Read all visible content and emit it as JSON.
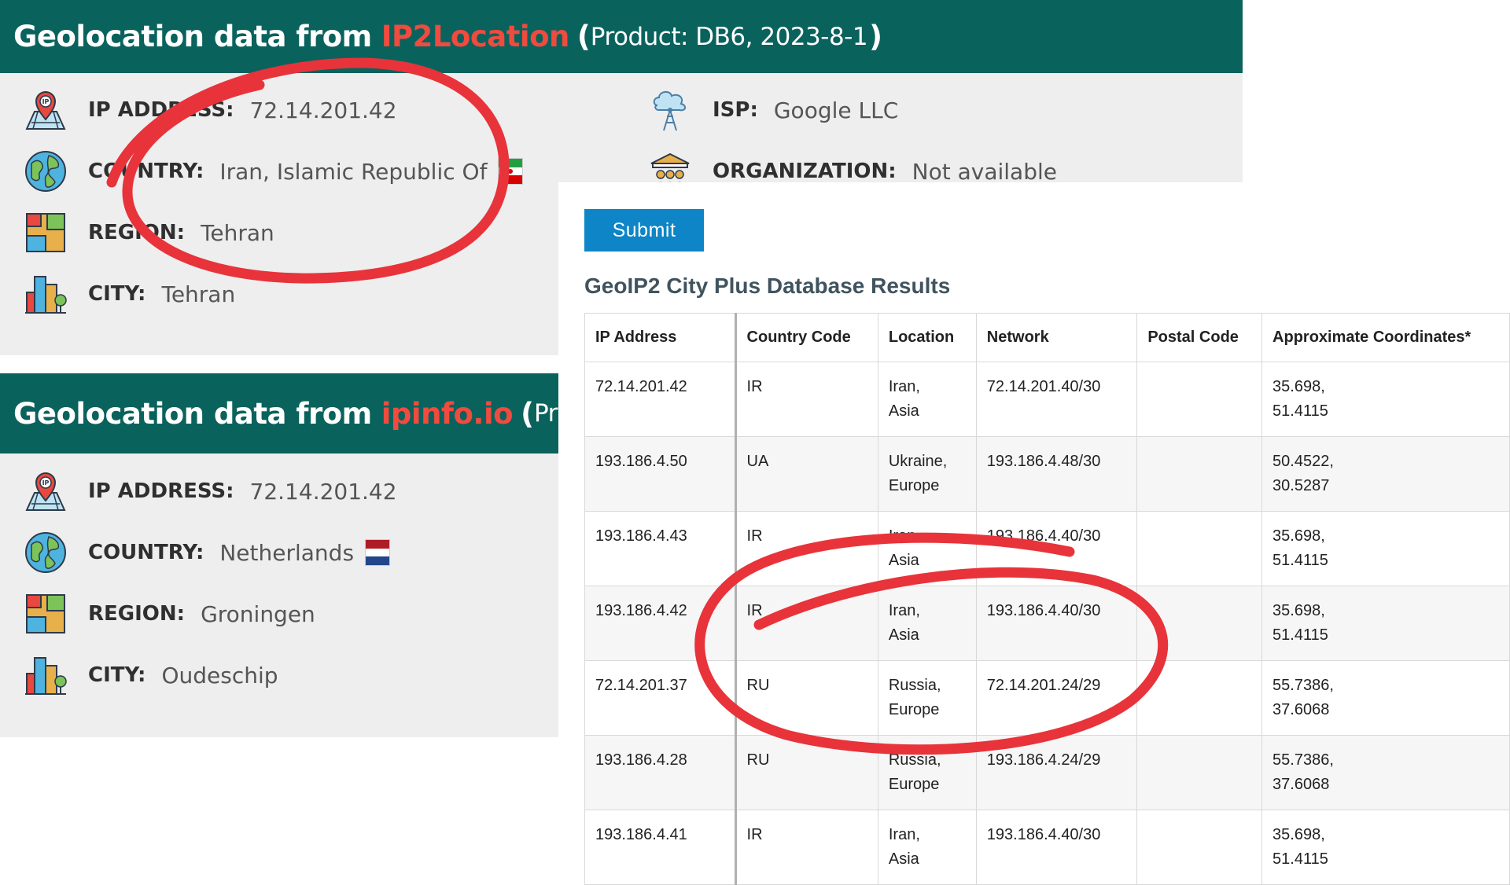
{
  "ip2location": {
    "header_main": "Geolocation data from",
    "header_brand": "IP2Location",
    "header_product": "Product: DB6, 2023-8-1",
    "rows": [
      {
        "label": "IP ADDRESS:",
        "value": "72.14.201.42",
        "icon": "ip-pin-icon"
      },
      {
        "label": "COUNTRY:",
        "value": "Iran, Islamic Republic Of",
        "icon": "globe-icon"
      },
      {
        "label": "REGION:",
        "value": "Tehran",
        "icon": "map-icon"
      },
      {
        "label": "CITY:",
        "value": "Tehran",
        "icon": "city-icon"
      }
    ],
    "right_rows": [
      {
        "label": "ISP:",
        "value": "Google LLC",
        "icon": "isp-tower-icon"
      },
      {
        "label": "ORGANIZATION:",
        "value": "Not available",
        "icon": "organization-icon"
      }
    ]
  },
  "ipinfo": {
    "header_main": "Geolocation data from",
    "header_brand": "ipinfo.io",
    "header_product": "Product:",
    "rows": [
      {
        "label": "IP ADDRESS:",
        "value": "72.14.201.42",
        "icon": "ip-pin-icon"
      },
      {
        "label": "COUNTRY:",
        "value": "Netherlands",
        "icon": "globe-icon"
      },
      {
        "label": "REGION:",
        "value": "Groningen",
        "icon": "map-icon"
      },
      {
        "label": "CITY:",
        "value": "Oudeschip",
        "icon": "city-icon"
      }
    ]
  },
  "maxmind": {
    "submit_label": "Submit",
    "title": "GeoIP2 City Plus Database Results",
    "columns": [
      "IP Address",
      "Country Code",
      "Location",
      "Network",
      "Postal Code",
      "Approximate Coordinates*"
    ],
    "rows": [
      {
        "ip": "72.14.201.42",
        "cc": "IR",
        "loc1": "Iran,",
        "loc2": "Asia",
        "network": "72.14.201.40/30",
        "postal": "",
        "coord1": "35.698,",
        "coord2": "51.4115"
      },
      {
        "ip": "193.186.4.50",
        "cc": "UA",
        "loc1": "Ukraine,",
        "loc2": "Europe",
        "network": "193.186.4.48/30",
        "postal": "",
        "coord1": "50.4522,",
        "coord2": "30.5287"
      },
      {
        "ip": "193.186.4.43",
        "cc": "IR",
        "loc1": "Iran,",
        "loc2": "Asia",
        "network": "193.186.4.40/30",
        "postal": "",
        "coord1": "35.698,",
        "coord2": "51.4115"
      },
      {
        "ip": "193.186.4.42",
        "cc": "IR",
        "loc1": "Iran,",
        "loc2": "Asia",
        "network": "193.186.4.40/30",
        "postal": "",
        "coord1": "35.698,",
        "coord2": "51.4115"
      },
      {
        "ip": "72.14.201.37",
        "cc": "RU",
        "loc1": "Russia,",
        "loc2": "Europe",
        "network": "72.14.201.24/29",
        "postal": "",
        "coord1": "55.7386,",
        "coord2": "37.6068"
      },
      {
        "ip": "193.186.4.28",
        "cc": "RU",
        "loc1": "Russia,",
        "loc2": "Europe",
        "network": "193.186.4.24/29",
        "postal": "",
        "coord1": "55.7386,",
        "coord2": "37.6068"
      },
      {
        "ip": "193.186.4.41",
        "cc": "IR",
        "loc1": "Iran,",
        "loc2": "Asia",
        "network": "193.186.4.40/30",
        "postal": "",
        "coord1": "35.698,",
        "coord2": "51.4115"
      }
    ]
  },
  "colors": {
    "header_bg": "#0a625d",
    "brand_red": "#f04b3e",
    "annotation_red": "#e8333a",
    "submit_blue": "#0d85c6"
  }
}
